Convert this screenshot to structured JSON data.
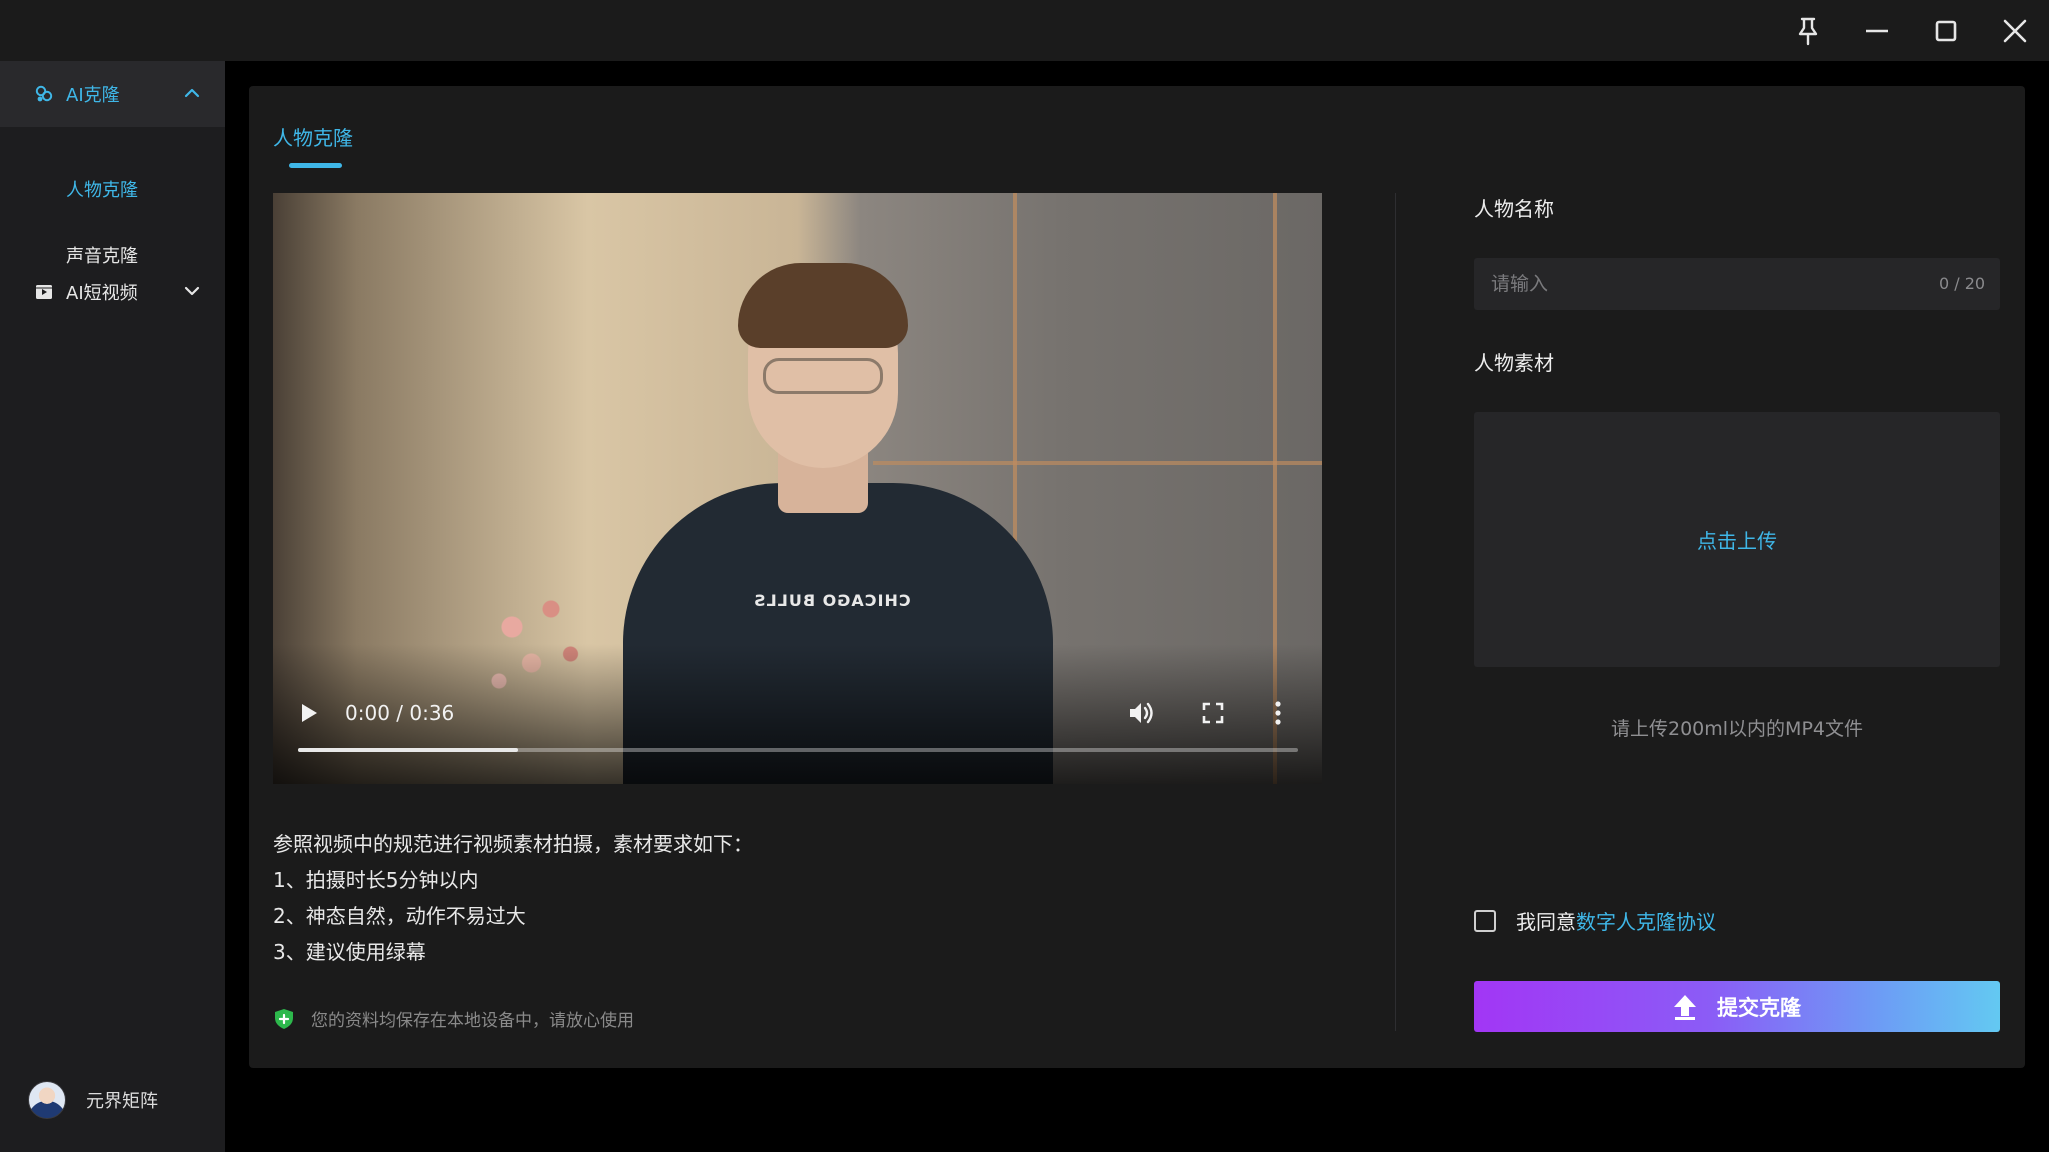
{
  "window": {
    "pin_icon": "pin-icon",
    "minimize_icon": "minimize-icon",
    "maximize_icon": "maximize-icon",
    "close_icon": "close-icon"
  },
  "sidebar": {
    "groups": [
      {
        "label": "AI克隆",
        "icon": "ai-clone-icon",
        "expanded": true,
        "items": [
          {
            "label": "人物克隆",
            "selected": true
          },
          {
            "label": "声音克隆",
            "selected": false
          }
        ]
      },
      {
        "label": "AI短视频",
        "icon": "video-icon",
        "expanded": false,
        "items": []
      }
    ],
    "user": {
      "name": "元界矩阵"
    }
  },
  "main": {
    "tab": "人物克隆",
    "video": {
      "time": "0:00 / 0:36",
      "progress": 0.22,
      "shirt_text": "CHICAGO BULLS"
    },
    "requirements": [
      "参照视频中的规范进行视频素材拍摄，素材要求如下：",
      "1、拍摄时长5分钟以内",
      "2、神态自然，动作不易过大",
      "3、建议使用绿幕"
    ],
    "notice": "您的资料均保存在本地设备中，请放心使用"
  },
  "form": {
    "name_label": "人物名称",
    "name_placeholder": "请输入",
    "name_value": "",
    "counter": "0 / 20",
    "material_label": "人物素材",
    "upload_label": "点击上传",
    "upload_hint": "请上传200ml以内的MP4文件",
    "agree_text": "我同意",
    "agree_link": "数字人克隆协议",
    "agree_checked": false,
    "submit_label": "提交克隆"
  },
  "colors": {
    "accent": "#3fb7e8",
    "background": "#000000",
    "panel": "#1b1b1b",
    "sidebar": "#1d1d1f",
    "submit_gradient_start": "#a236f5",
    "submit_gradient_end": "#63c9f2"
  }
}
